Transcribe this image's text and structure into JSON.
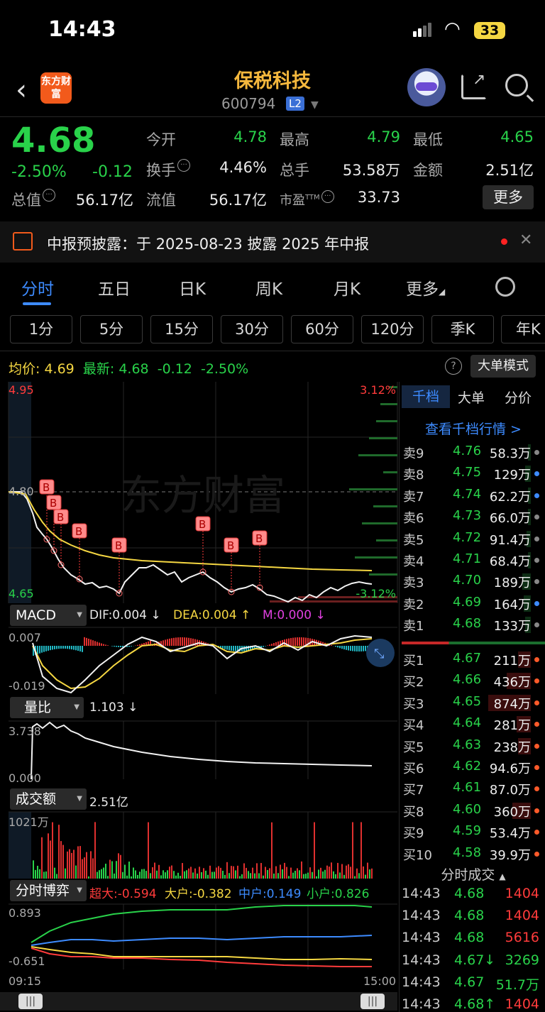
{
  "status": {
    "time": "14:43",
    "battery": "33"
  },
  "header": {
    "logo": "东方财富",
    "name": "保税科技",
    "code": "600794",
    "level": "L2"
  },
  "quote": {
    "price": "4.68",
    "pct": "-2.50%",
    "change": "-0.12",
    "open_label": "今开",
    "open": "4.78",
    "high_label": "最高",
    "high": "4.79",
    "low_label": "最低",
    "low": "4.65",
    "turnover_label": "换手",
    "turnover": "4.46%",
    "volume_label": "总手",
    "volume": "53.58万",
    "amount_label": "金额",
    "amount": "2.51亿",
    "mcap_label": "总值",
    "mcap": "56.17亿",
    "float_label": "流值",
    "float": "56.17亿",
    "pe_label": "市盈",
    "pe_sup": "TTM",
    "pe": "33.73",
    "more": "更多"
  },
  "notice": {
    "text": "中报预披露：于 2025-08-23 披露 2025 年中报"
  },
  "tabs": [
    "分时",
    "五日",
    "日K",
    "周K",
    "月K",
    "更多"
  ],
  "periods": [
    "1分",
    "5分",
    "15分",
    "30分",
    "60分",
    "120分",
    "季K",
    "年K"
  ],
  "infoline": {
    "avg_label": "均价:",
    "avg": "4.69",
    "last_label": "最新:",
    "last": "4.68",
    "change": "-0.12",
    "pct": "-2.50%",
    "bigorder": "大单模式"
  },
  "chart": {
    "watermark": "东方财富",
    "price_top": "4.95",
    "price_mid": "4.80",
    "price_bottom": "4.65",
    "pct_top": "3.12%",
    "pct_bottom": "-3.12%",
    "time_start": "09:15",
    "time_end": "15:00",
    "buy_marker": "B"
  },
  "macd": {
    "label": "MACD",
    "dif": "DIF:0.004 ↓",
    "dea": "DEA:0.004 ↑",
    "m": "M:0.000 ↓",
    "top": "0.007",
    "bottom": "-0.019"
  },
  "volratio": {
    "label": "量比",
    "value": "1.103 ↓",
    "top": "3.738",
    "bottom": "0.000"
  },
  "amount": {
    "label": "成交额",
    "value": "2.51亿",
    "top": "1021万"
  },
  "game": {
    "label": "分时博弈",
    "super": "超大:-0.594",
    "big": "大户:-0.382",
    "mid": "中户:0.149",
    "small": "小户:0.826",
    "top": "0.893",
    "bottom": "-0.651"
  },
  "right_panel": {
    "tabs": [
      "千档",
      "大单",
      "分价"
    ],
    "link": "查看千档行情 >",
    "asks": [
      {
        "side": "卖9",
        "price": "4.76",
        "vol": "58.3万"
      },
      {
        "side": "卖8",
        "price": "4.75",
        "vol": "129万"
      },
      {
        "side": "卖7",
        "price": "4.74",
        "vol": "62.2万"
      },
      {
        "side": "卖6",
        "price": "4.73",
        "vol": "66.0万"
      },
      {
        "side": "卖5",
        "price": "4.72",
        "vol": "91.4万"
      },
      {
        "side": "卖4",
        "price": "4.71",
        "vol": "68.4万"
      },
      {
        "side": "卖3",
        "price": "4.70",
        "vol": "189万"
      },
      {
        "side": "卖2",
        "price": "4.69",
        "vol": "164万"
      },
      {
        "side": "卖1",
        "price": "4.68",
        "vol": "133万"
      }
    ],
    "bids": [
      {
        "side": "买1",
        "price": "4.67",
        "vol": "211万"
      },
      {
        "side": "买2",
        "price": "4.66",
        "vol": "436万"
      },
      {
        "side": "买3",
        "price": "4.65",
        "vol": "874万"
      },
      {
        "side": "买4",
        "price": "4.64",
        "vol": "281万"
      },
      {
        "side": "买5",
        "price": "4.63",
        "vol": "238万"
      },
      {
        "side": "买6",
        "price": "4.62",
        "vol": "94.6万"
      },
      {
        "side": "买7",
        "price": "4.61",
        "vol": "87.0万"
      },
      {
        "side": "买8",
        "price": "4.60",
        "vol": "360万"
      },
      {
        "side": "买9",
        "price": "4.59",
        "vol": "53.4万"
      },
      {
        "side": "买10",
        "price": "4.58",
        "vol": "39.9万"
      }
    ],
    "trades_title": "分时成交",
    "trades": [
      {
        "time": "14:43",
        "price": "4.68",
        "vol": "1404",
        "color": "#ff3b3b",
        "pcolor": "#29d24a"
      },
      {
        "time": "14:43",
        "price": "4.68",
        "vol": "1404",
        "color": "#ff3b3b",
        "pcolor": "#29d24a"
      },
      {
        "time": "14:43",
        "price": "4.68",
        "vol": "5616",
        "color": "#ff3b3b",
        "pcolor": "#29d24a"
      },
      {
        "time": "14:43",
        "price": "4.67↓",
        "vol": "3269",
        "color": "#29d24a",
        "pcolor": "#29d24a"
      },
      {
        "time": "14:43",
        "price": "4.67",
        "vol": "51.7万",
        "color": "#29d24a",
        "pcolor": "#29d24a"
      },
      {
        "time": "14:43",
        "price": "4.68↑",
        "vol": "1404",
        "color": "#ff3b3b",
        "pcolor": "#29d24a"
      }
    ]
  }
}
